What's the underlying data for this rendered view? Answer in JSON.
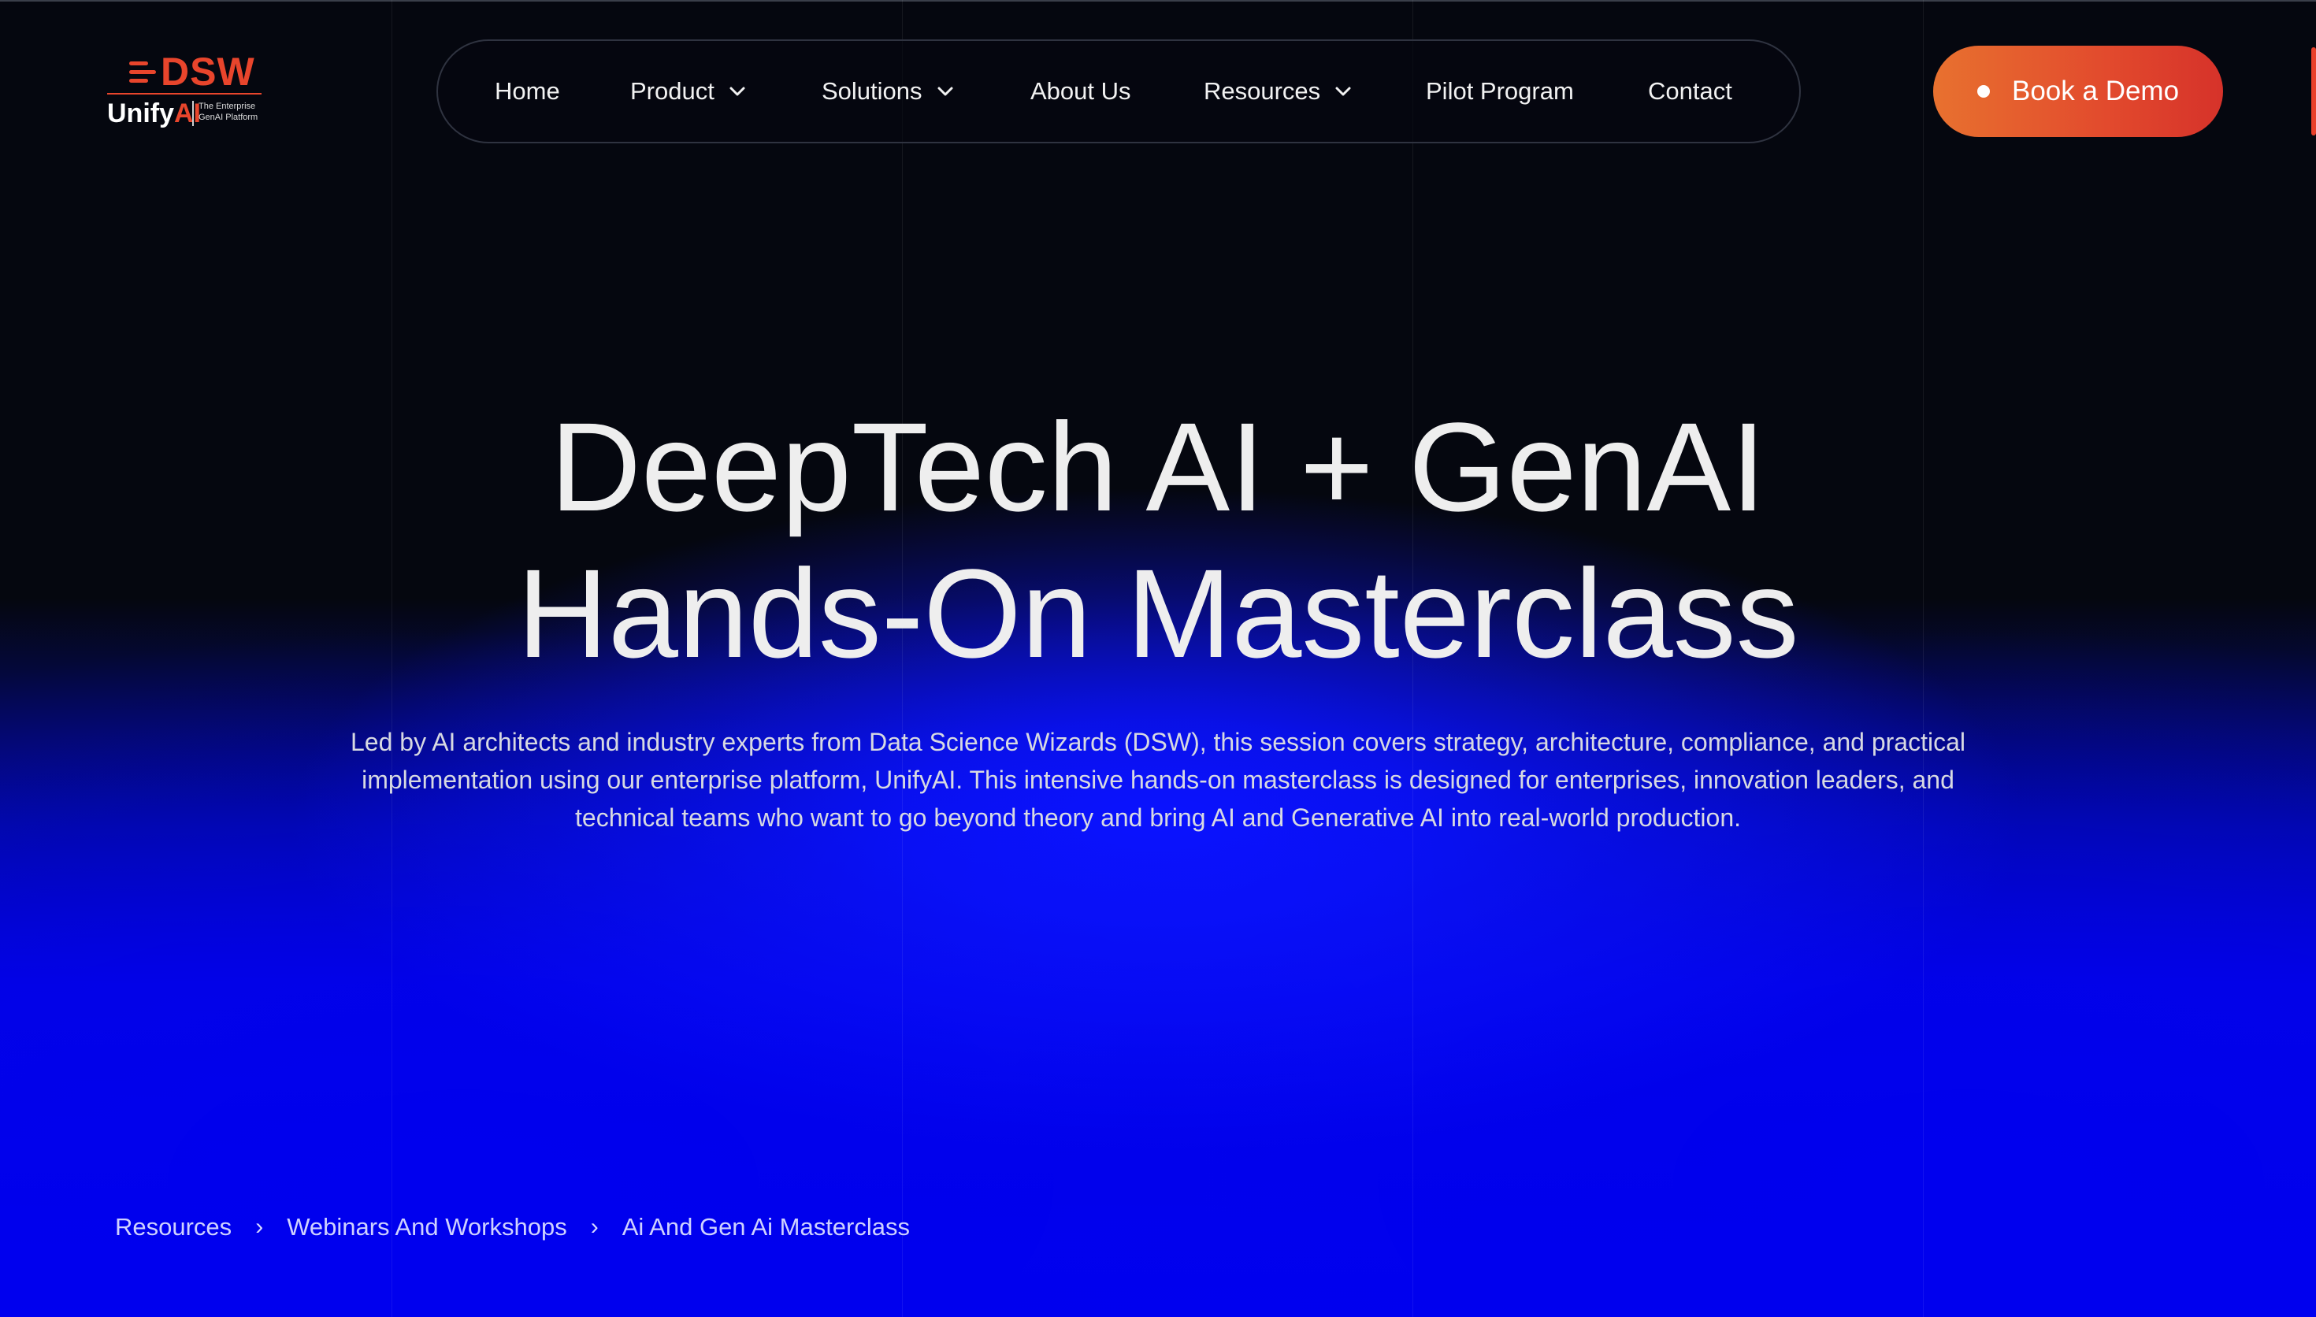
{
  "logo": {
    "brand": "DSW",
    "product_main": "Unify",
    "product_accent": "AI",
    "tagline_line1": "The Enterprise",
    "tagline_line2": "GenAI Platform",
    "accent_color": "#e8452c"
  },
  "nav": {
    "items": [
      {
        "label": "Home",
        "has_dropdown": false
      },
      {
        "label": "Product",
        "has_dropdown": true
      },
      {
        "label": "Solutions",
        "has_dropdown": true
      },
      {
        "label": "About Us",
        "has_dropdown": false
      },
      {
        "label": "Resources",
        "has_dropdown": true
      },
      {
        "label": "Pilot Program",
        "has_dropdown": false
      },
      {
        "label": "Contact",
        "has_dropdown": false
      }
    ]
  },
  "cta": {
    "label": "Book a Demo",
    "gradient_start": "#e8712f",
    "gradient_end": "#d6322a"
  },
  "hero": {
    "title_line1": "DeepTech AI + GenAI",
    "title_line2": "Hands-On Masterclass",
    "description": "Led by AI architects and industry experts from Data Science Wizards (DSW), this session covers strategy, architecture, compliance, and practical implementation using our enterprise platform, UnifyAI. This intensive hands-on masterclass is designed for enterprises, innovation leaders, and technical teams who want to go beyond theory and bring AI and Generative AI into real-world production."
  },
  "breadcrumb": {
    "items": [
      "Resources",
      "Webinars And Workshops",
      "Ai And Gen Ai Masterclass"
    ],
    "separator": "›"
  },
  "colors": {
    "background": "#05070f",
    "glow": "#0000f0"
  }
}
